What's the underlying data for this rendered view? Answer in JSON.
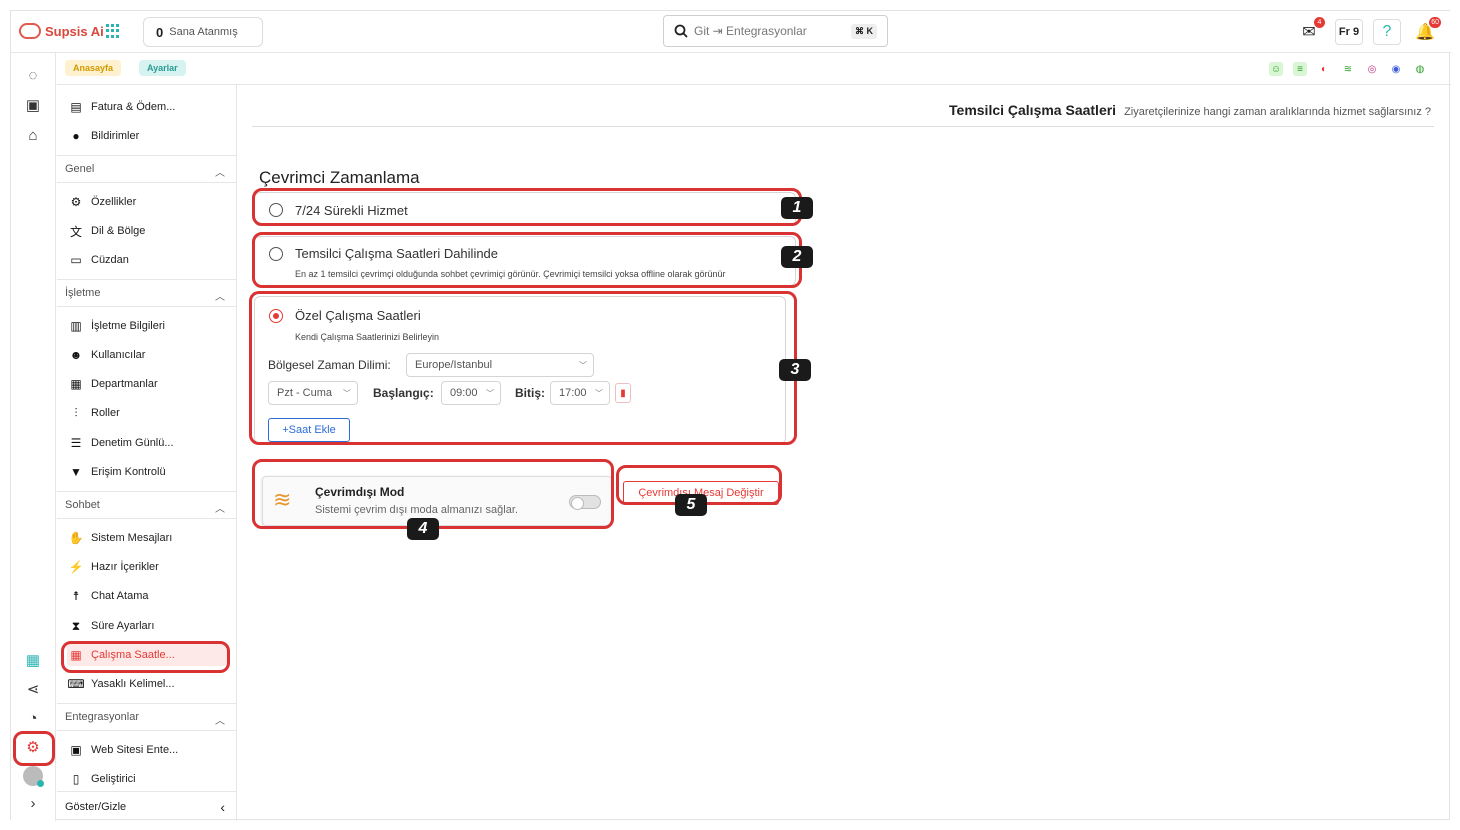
{
  "brand": {
    "name": "Supsis Ai",
    "color": "#d9463b",
    "accent": "#2bb5b0"
  },
  "topbar": {
    "assigned_count": "0",
    "assigned_label": "Sana Atanmış",
    "search_placeholder": "Git ⇥ Entegrasyonlar",
    "search_shortcut": "⌘ K",
    "mail_badge": "4",
    "lang_label": "Fr 9",
    "notif_badge": "60"
  },
  "breadcrumb": {
    "home": "Anasayfa",
    "settings": "Ayarlar"
  },
  "sidebar": {
    "top_items": [
      {
        "label": "Fatura & Ödem...",
        "icon": "invoice-icon"
      },
      {
        "label": "Bildirimler",
        "icon": "bell-icon"
      }
    ],
    "sections": [
      {
        "title": "Genel",
        "items": [
          {
            "label": "Özellikler",
            "icon": "gear-icon"
          },
          {
            "label": "Dil & Bölge",
            "icon": "translate-icon"
          },
          {
            "label": "Cüzdan",
            "icon": "wallet-icon"
          }
        ]
      },
      {
        "title": "İşletme",
        "items": [
          {
            "label": "İşletme Bilgileri",
            "icon": "building-icon"
          },
          {
            "label": "Kullanıcılar",
            "icon": "users-icon"
          },
          {
            "label": "Departmanlar",
            "icon": "department-icon"
          },
          {
            "label": "Roller",
            "icon": "roles-icon"
          },
          {
            "label": "Denetim Günlü...",
            "icon": "list-icon"
          },
          {
            "label": "Erişim Kontrolü",
            "icon": "wifi-lock-icon"
          }
        ]
      },
      {
        "title": "Sohbet",
        "items": [
          {
            "label": "Sistem Mesajları",
            "icon": "wave-icon"
          },
          {
            "label": "Hazır İçerikler",
            "icon": "bolt-icon"
          },
          {
            "label": "Chat Atama",
            "icon": "person-icon"
          },
          {
            "label": "Süre Ayarları",
            "icon": "hourglass-icon"
          },
          {
            "label": "Çalışma Saatle...",
            "icon": "calendar-icon"
          },
          {
            "label": "Yasaklı Kelimel...",
            "icon": "keyboard-icon"
          }
        ]
      },
      {
        "title": "Entegrasyonlar",
        "items": [
          {
            "label": "Web Sitesi Ente...",
            "icon": "code-icon"
          },
          {
            "label": "Geliştirici",
            "icon": "dev-icon"
          }
        ]
      }
    ],
    "toggle_label": "Göster/Gizle"
  },
  "main": {
    "title": "Temsilci Çalışma Saatleri",
    "subtitle": "Ziyaretçilerinize hangi zaman aralıklarında hizmet sağlarsınız ?",
    "schedule_title": "Çevrimci Zamanlama",
    "options": [
      {
        "label": "7/24 Sürekli Hizmet",
        "desc": "",
        "selected": false
      },
      {
        "label": "Temsilci Çalışma Saatleri Dahilinde",
        "desc": "En az 1 temsilci çevrimçi olduğunda sohbet çevrimiçi görünür. Çevrimiçi temsilci yoksa offline olarak görünür",
        "selected": false
      },
      {
        "label": "Özel Çalışma Saatleri",
        "desc": "Kendi Çalışma Saatlerinizi Belirleyin",
        "selected": true
      }
    ],
    "timezone_label": "Bölgesel Zaman Dilimi:",
    "timezone_value": "Europe/Istanbul",
    "days_value": "Pzt - Cuma",
    "start_label": "Başlangıç:",
    "start_value": "09:00",
    "end_label": "Bitiş:",
    "end_value": "17:00",
    "add_hour_label": "+Saat Ekle",
    "offline_title": "Çevrimdışı Mod",
    "offline_desc": "Sistemi çevrim dışı moda almanızı sağlar.",
    "offline_enabled": false,
    "offline_message_btn": "Çevrimdışı Mesaj Değiştir"
  },
  "annotations": [
    "1",
    "2",
    "3",
    "4",
    "5"
  ]
}
